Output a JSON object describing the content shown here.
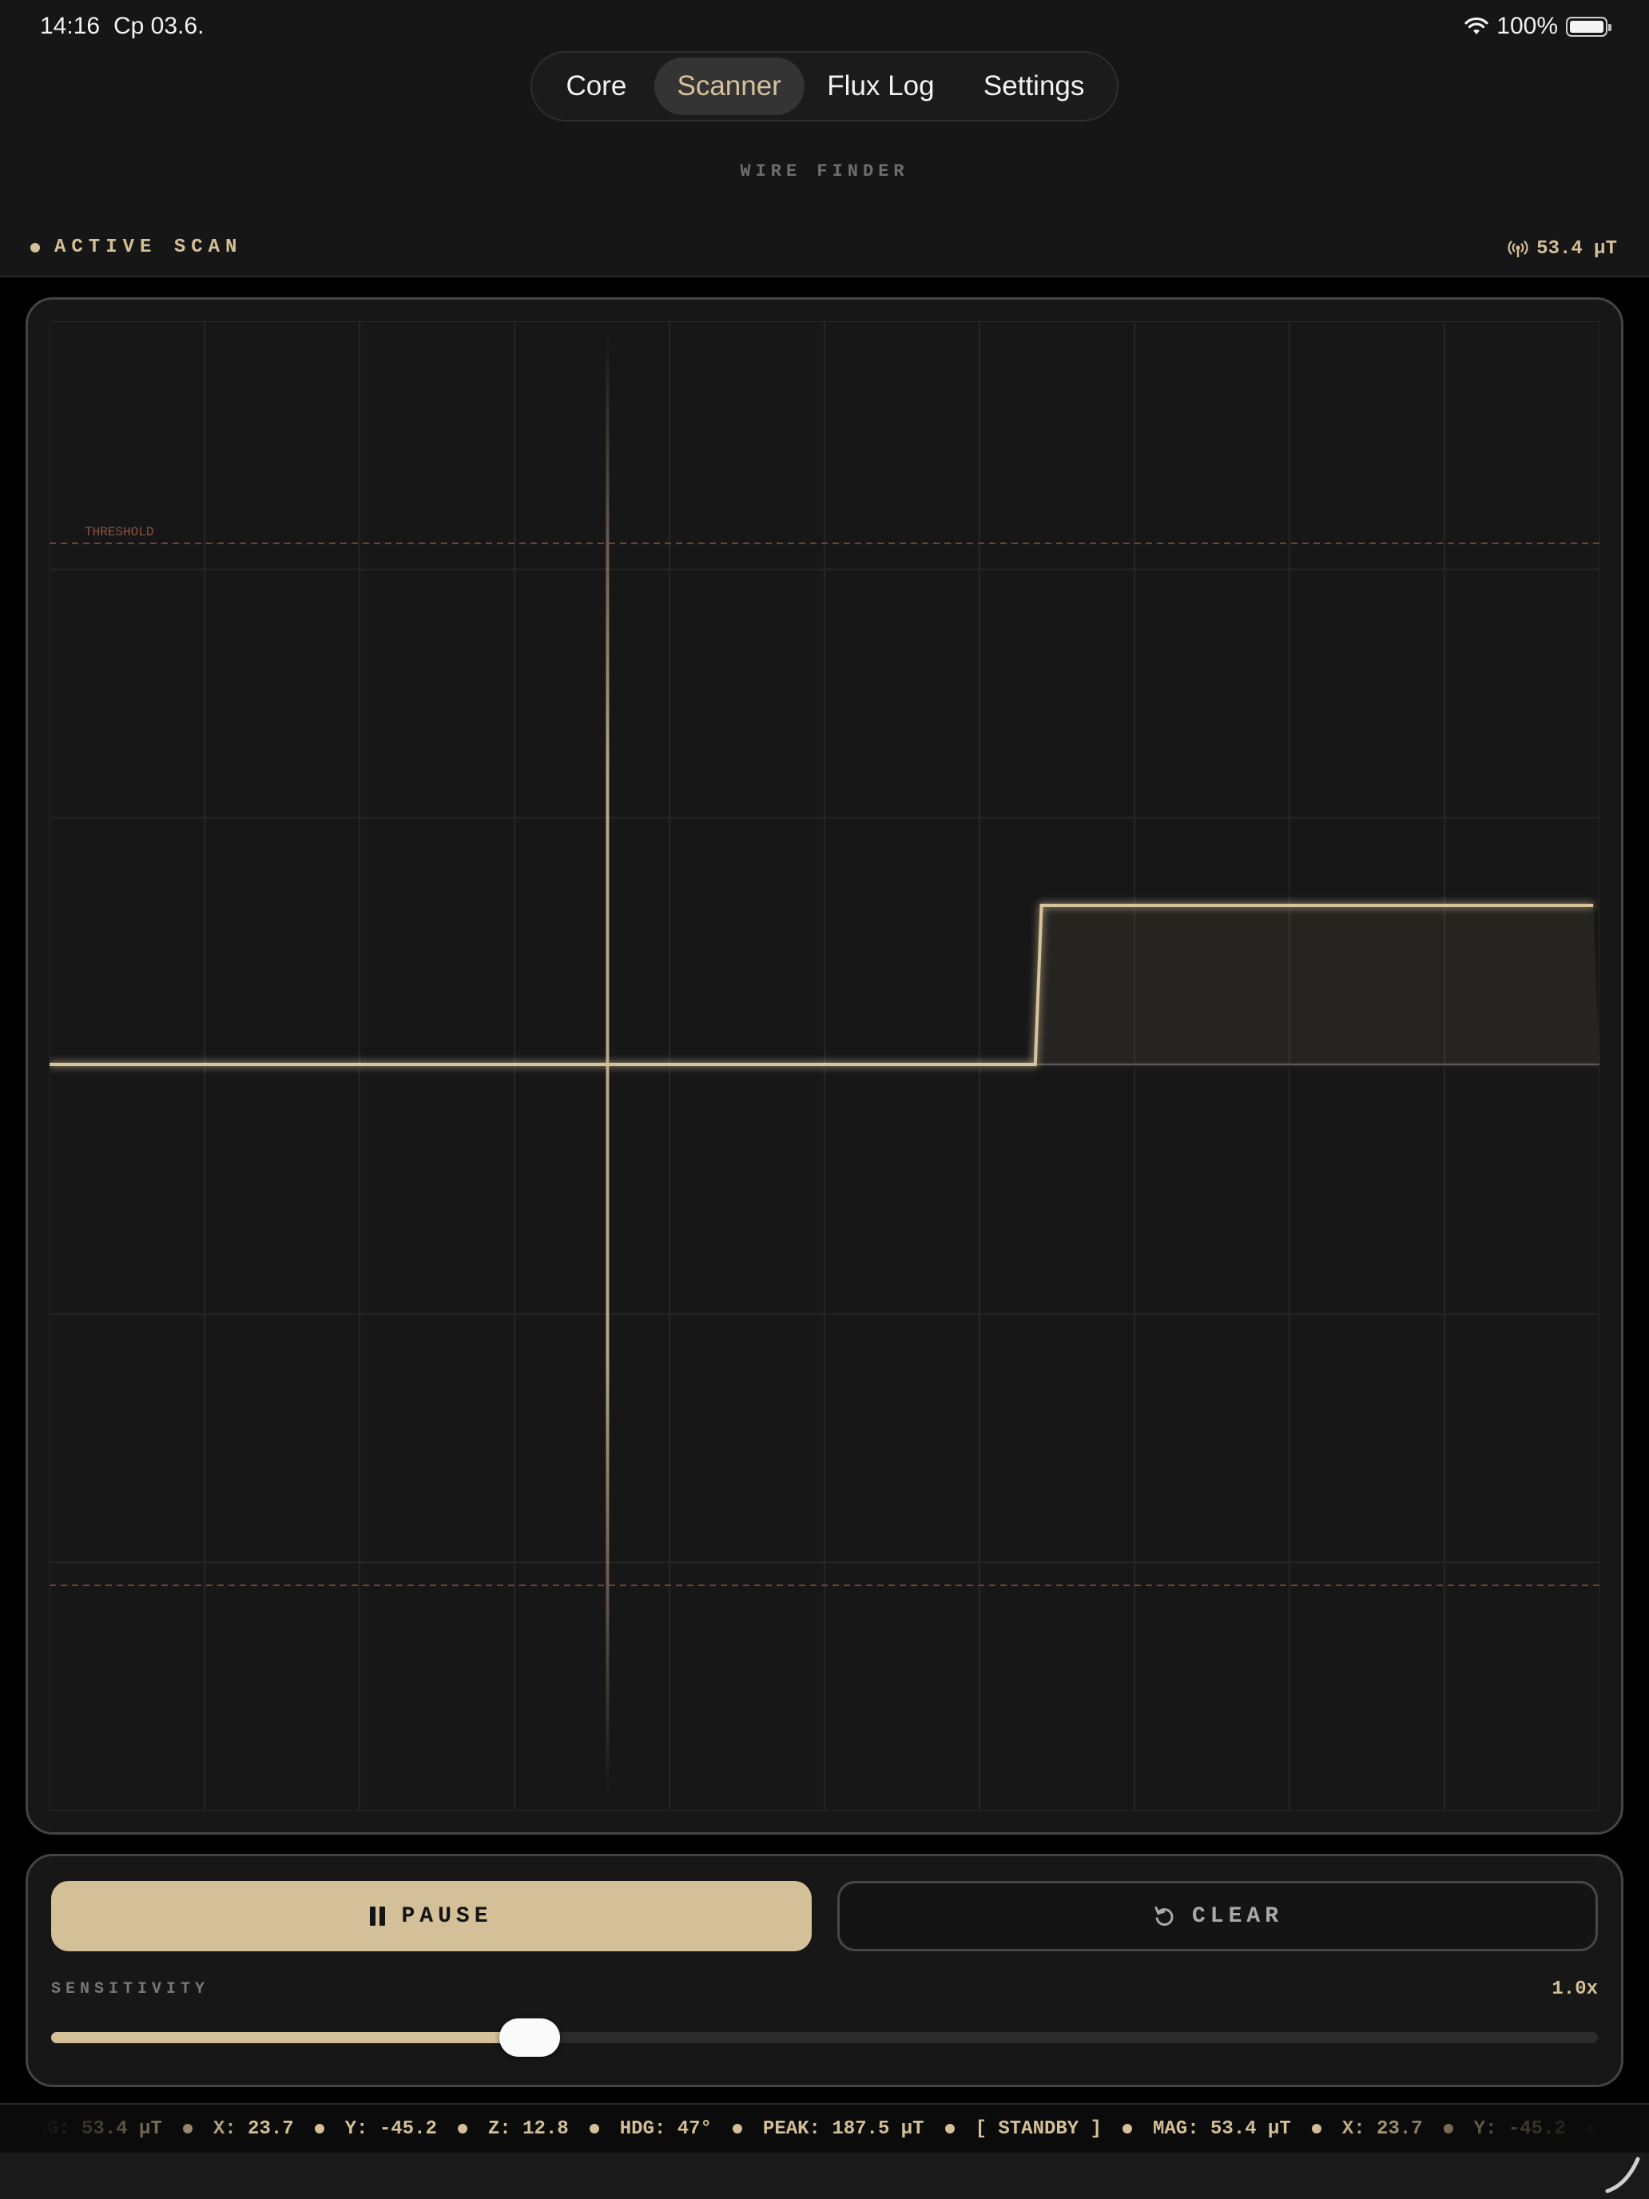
{
  "status_bar": {
    "time": "14:16",
    "date": "Cp 03.6.",
    "battery": "100%"
  },
  "tabs": [
    {
      "label": "Core",
      "active": false
    },
    {
      "label": "Scanner",
      "active": true
    },
    {
      "label": "Flux Log",
      "active": false
    },
    {
      "label": "Settings",
      "active": false
    }
  ],
  "subtitle": "WIRE FINDER",
  "header": {
    "status": "ACTIVE SCAN",
    "magnitude": "53.4 µT",
    "icon": "broadcast-signal-icon"
  },
  "scope": {
    "threshold_label": "THRESHOLD",
    "signal": {
      "x": [
        0,
        0.636,
        0.64,
        0.996,
        1.0
      ],
      "y": [
        0,
        0,
        1,
        1,
        0
      ],
      "note_level_units": "relative"
    },
    "threshold_level": 3.0,
    "baseline_level": 0,
    "cursor_fraction": 0.36
  },
  "controls": {
    "pause_label": "PAUSE",
    "clear_label": "CLEAR",
    "sensitivity_label": "SENSITIVITY",
    "sensitivity_value": "1.0x",
    "sensitivity_fraction": 0.29
  },
  "ticker": {
    "items": [
      "MAG: 53.4 µT",
      "X: 23.7",
      "Y: -45.2",
      "Z: 12.8",
      "HDG: 47°",
      "PEAK: 187.5 µT",
      "[ STANDBY ]",
      "MAG: 53.4 µT",
      "X: 23.7",
      "Y: -45.2",
      "Z: 12.8"
    ]
  },
  "colors": {
    "accent": "#d3c099",
    "threshold": "#7a4a3c",
    "background": "#161616"
  }
}
